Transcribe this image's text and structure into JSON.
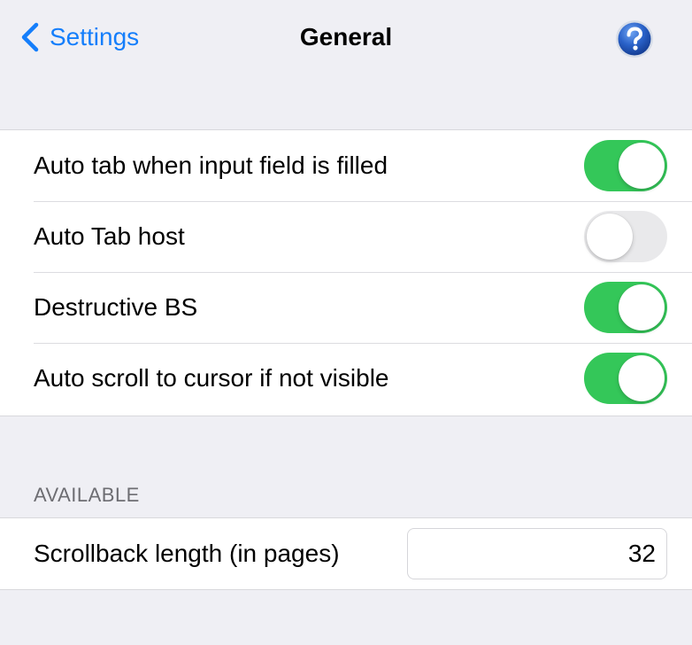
{
  "navbar": {
    "back_label": "Settings",
    "title": "General",
    "help_icon": "question-circle-icon"
  },
  "toggles": [
    {
      "label": "Auto tab when input field is filled",
      "on": true
    },
    {
      "label": "Auto Tab host",
      "on": false
    },
    {
      "label": "Destructive BS",
      "on": true
    },
    {
      "label": "Auto scroll to cursor if not visible",
      "on": true
    }
  ],
  "available_section": {
    "header": "AVAILABLE",
    "scrollback_label": "Scrollback length (in pages)",
    "scrollback_value": "32"
  },
  "colors": {
    "accent": "#147efb",
    "switch_on": "#34c759",
    "switch_off": "#e9e9eb",
    "background": "#efeff4"
  }
}
